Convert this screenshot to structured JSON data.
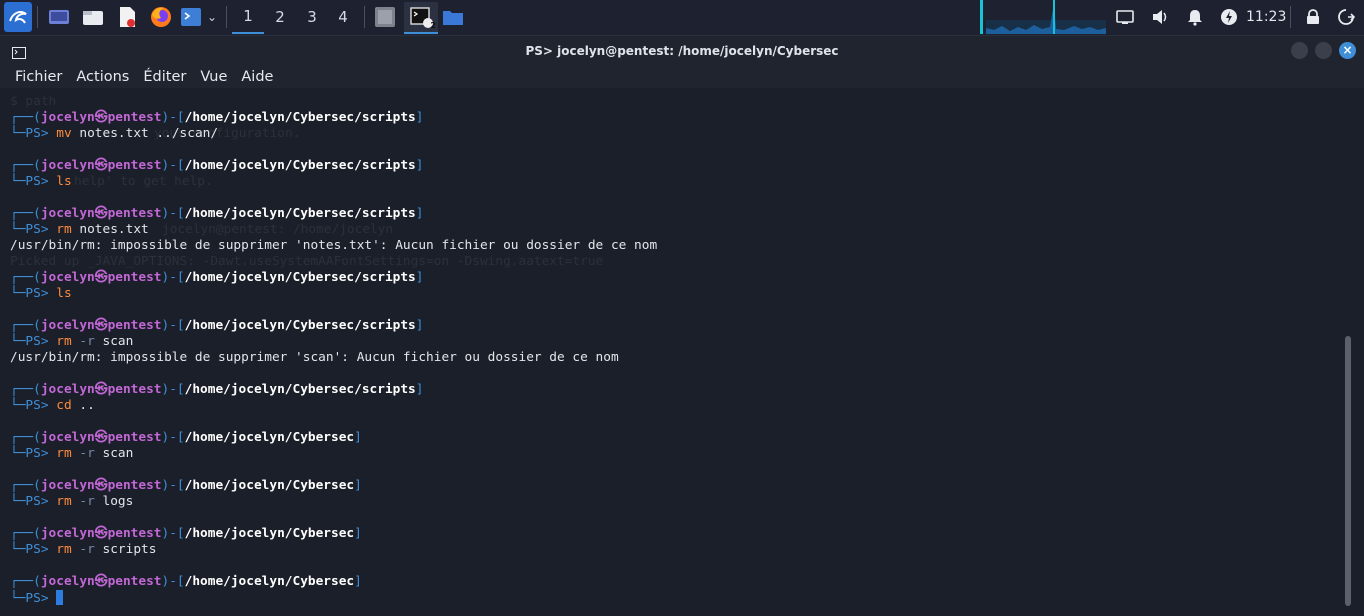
{
  "panel": {
    "workspaces": [
      "1",
      "2",
      "3",
      "4"
    ],
    "clock": "11:23",
    "terminal_badge": "2"
  },
  "window": {
    "title": "PS> jocelyn@pentest: /home/jocelyn/Cybersec",
    "close_glyph": "×"
  },
  "menu": [
    "Fichier",
    "Actions",
    "Éditer",
    "Vue",
    "Aide"
  ],
  "terminal": {
    "ghost_lines": [
      "$ path",
      "your configuration.",
      "help' to get help.",
      "jocelyn@pentest: /home/jocelyn",
      "Picked up _JAVA_OPTIONS: -Dawt.useSystemAAFontSettings=on -Dswing.aatext=true"
    ],
    "blocks": [
      {
        "user": "jocelyn",
        "host": "pentest",
        "path": "/home/jocelyn/Cybersec/scripts",
        "cmd": "mv",
        "args": " notes.txt ../scan/",
        "output": ""
      },
      {
        "user": "jocelyn",
        "host": "pentest",
        "path": "/home/jocelyn/Cybersec/scripts",
        "cmd": "ls",
        "args": "",
        "output": ""
      },
      {
        "user": "jocelyn",
        "host": "pentest",
        "path": "/home/jocelyn/Cybersec/scripts",
        "cmd": "rm",
        "args": " notes.txt",
        "output": "/usr/bin/rm: impossible de supprimer 'notes.txt': Aucun fichier ou dossier de ce nom"
      },
      {
        "user": "jocelyn",
        "host": "pentest",
        "path": "/home/jocelyn/Cybersec/scripts",
        "cmd": "ls",
        "args": "",
        "output": ""
      },
      {
        "user": "jocelyn",
        "host": "pentest",
        "path": "/home/jocelyn/Cybersec/scripts",
        "cmd": "rm",
        "flag": " -r",
        "args": " scan",
        "output": "/usr/bin/rm: impossible de supprimer 'scan': Aucun fichier ou dossier de ce nom"
      },
      {
        "user": "jocelyn",
        "host": "pentest",
        "path": "/home/jocelyn/Cybersec/scripts",
        "cmd": "cd",
        "args": " ..",
        "output": ""
      },
      {
        "user": "jocelyn",
        "host": "pentest",
        "path": "/home/jocelyn/Cybersec",
        "cmd": "rm",
        "flag": " -r",
        "args": " scan",
        "output": ""
      },
      {
        "user": "jocelyn",
        "host": "pentest",
        "path": "/home/jocelyn/Cybersec",
        "cmd": "rm",
        "flag": " -r",
        "args": " logs",
        "output": ""
      },
      {
        "user": "jocelyn",
        "host": "pentest",
        "path": "/home/jocelyn/Cybersec",
        "cmd": "rm",
        "flag": " -r",
        "args": " scripts",
        "output": ""
      },
      {
        "user": "jocelyn",
        "host": "pentest",
        "path": "/home/jocelyn/Cybersec",
        "cmd": "",
        "args": "",
        "output": "",
        "active": true
      }
    ],
    "prompt_label": "PS>",
    "at_glyph": "㉿"
  },
  "icons": {
    "app_menu": "kali-dragon-icon",
    "desktop": "show-desktop-icon",
    "files": "file-manager-icon",
    "editor": "text-editor-icon",
    "firefox": "firefox-icon",
    "terminal": "terminal-icon",
    "network": "network-icon",
    "volume": "volume-icon",
    "notifications": "bell-icon",
    "power": "power-icon",
    "lock": "lock-icon",
    "logout": "logout-icon"
  },
  "colors": {
    "accent": "#3e8fd8",
    "user": "#c267d6",
    "command": "#ff8a3c",
    "background": "#1b1f29"
  }
}
